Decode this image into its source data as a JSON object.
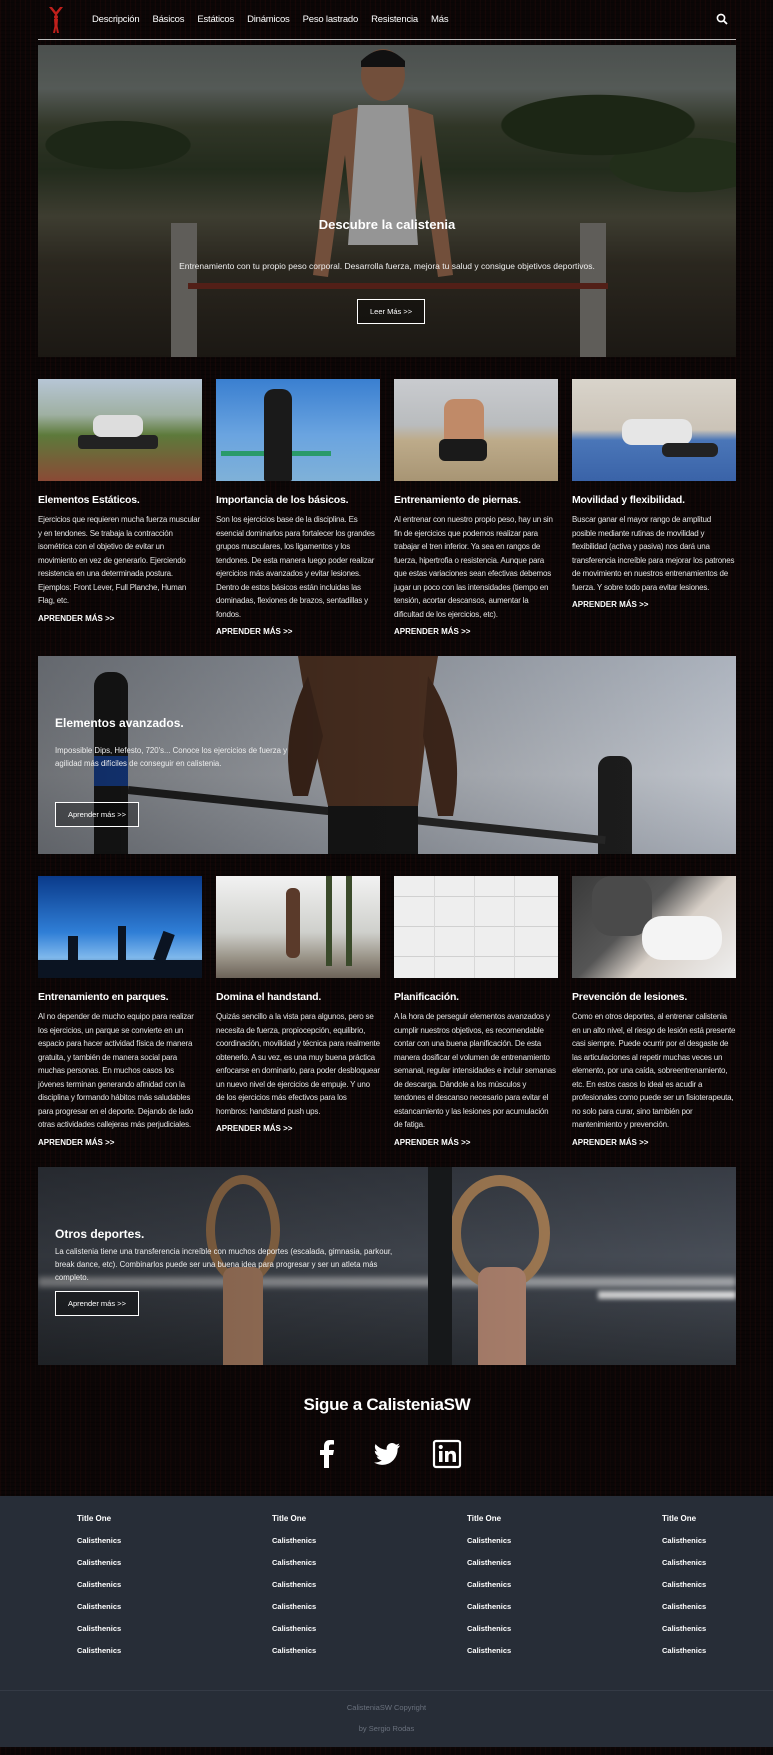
{
  "nav": {
    "items": [
      "Descripción",
      "Básicos",
      "Estáticos",
      "Dinámicos",
      "Peso lastrado",
      "Resistencia",
      "Más"
    ]
  },
  "hero": {
    "title": "Descubre la calistenia",
    "subtitle": "Entrenamiento con tu propio peso corporal. Desarrolla fuerza, mejora tu salud y consigue objetivos deportivos.",
    "button": "Leer Más >>"
  },
  "cards_row1": [
    {
      "title": "Elementos Estáticos.",
      "text": "Ejercicios que requieren mucha fuerza muscular y en tendones. Se trabaja la contracción isométrica con el objetivo de evitar un movimiento en vez de generarlo. Ejerciendo resistencia en una determinada postura. Ejemplos: Front Lever, Full Planche, Human Flag, etc.",
      "link": "APRENDER MÁS >>"
    },
    {
      "title": "Importancia de los básicos.",
      "text": "Son los ejercicios base de la disciplina. Es esencial dominarlos para fortalecer los grandes grupos musculares, los ligamentos y los tendones. De esta manera luego poder realizar ejercicios más avanzados y evitar lesiones. Dentro de estos básicos están incluidas las dominadas, flexiones de brazos, sentadillas y fondos.",
      "link": "APRENDER MÁS >>"
    },
    {
      "title": "Entrenamiento de piernas.",
      "text": "Al entrenar con nuestro propio peso, hay un sin fin de ejercicios que podemos realizar para trabajar el tren inferior. Ya sea en rangos de fuerza, hipertrofia o resistencia. Aunque para que estas variaciones sean efectivas debemos jugar un poco con las intensidades (tiempo en tensión, acortar descansos, aumentar la dificultad de los ejercicios, etc).",
      "link": "APRENDER MÁS >>"
    },
    {
      "title": "Movilidad y flexibilidad.",
      "text": "Buscar ganar el mayor rango de amplitud posible mediante rutinas de movilidad y flexibilidad (activa y pasiva) nos dará una transferencia increíble para mejorar los patrones de movimiento en nuestros entrenamientos de fuerza. Y sobre todo para evitar lesiones.",
      "link": "APRENDER MÁS >>"
    }
  ],
  "banner1": {
    "title": "Elementos avanzados.",
    "text": "Impossible Dips, Hefesto, 720's... Conoce los ejercicios de fuerza y agilidad más difíciles de conseguir en calistenia.",
    "button": "Aprender más >>"
  },
  "cards_row2": [
    {
      "title": "Entrenamiento en parques.",
      "text": "Al no depender de mucho equipo para realizar los ejercicios, un parque se convierte en un espacio para hacer actividad física de manera gratuita, y también de manera social para muchas personas. En muchos casos los jóvenes terminan generando afinidad con la disciplina y formando hábitos más saludables para progresar en el deporte. Dejando de lado otras actividades callejeras más perjudiciales.",
      "link": "APRENDER MÁS >>"
    },
    {
      "title": "Domina el handstand.",
      "text": "Quizás sencillo a la vista para algunos, pero se necesita de fuerza, propiocepción, equilibrio, coordinación, movilidad y técnica para realmente obtenerlo. A su vez, es una muy buena práctica enfocarse en dominarlo, para poder desbloquear un nuevo nivel de ejercicios de empuje. Y uno de los ejercicios más efectivos para los hombros: handstand push ups.",
      "link": "APRENDER MÁS >>"
    },
    {
      "title": "Planificación.",
      "text": "A la hora de perseguir elementos avanzados y cumplir nuestros objetivos, es recomendable contar con una buena planificación. De esta manera dosificar el volumen de entrenamiento semanal, regular intensidades e incluir semanas de descarga. Dándole a los músculos y tendones el descanso necesario para evitar el estancamiento y las lesiones por acumulación de fatiga.",
      "link": "APRENDER MÁS >>"
    },
    {
      "title": "Prevención de lesiones.",
      "text": "Como en otros deportes, al entrenar calistenia en un alto nivel, el riesgo de lesión está presente casi siempre. Puede ocurrir por el desgaste de las articulaciones al repetir muchas veces un elemento, por una caída, sobreentrenamiento, etc. En estos casos lo ideal es acudir a profesionales como puede ser un fisioterapeuta, no solo para curar, sino también por mantenimiento y prevención.",
      "link": "APRENDER MÁS >>"
    }
  ],
  "banner2": {
    "title": "Otros deportes.",
    "text": "La calistenia tiene una transferencia increíble con muchos deportes (escalada, gimnasia, parkour, break dance, etc). Combinarlos puede ser una buena idea para progresar y ser un atleta más completo.",
    "button": "Aprender más >>"
  },
  "social": {
    "title": "Sigue a CalisteniaSW",
    "icons": [
      "facebook-icon",
      "twitter-icon",
      "linkedin-icon"
    ]
  },
  "footer": {
    "columns": [
      {
        "title": "Title One",
        "links": [
          "Calisthenics",
          "Calisthenics",
          "Calisthenics",
          "Calisthenics",
          "Calisthenics",
          "Calisthenics"
        ]
      },
      {
        "title": "Title One",
        "links": [
          "Calisthenics",
          "Calisthenics",
          "Calisthenics",
          "Calisthenics",
          "Calisthenics",
          "Calisthenics"
        ]
      },
      {
        "title": "Title One",
        "links": [
          "Calisthenics",
          "Calisthenics",
          "Calisthenics",
          "Calisthenics",
          "Calisthenics",
          "Calisthenics"
        ]
      },
      {
        "title": "Title One",
        "links": [
          "Calisthenics",
          "Calisthenics",
          "Calisthenics",
          "Calisthenics",
          "Calisthenics",
          "Calisthenics"
        ]
      }
    ],
    "copyright": "CalisteniaSW Copyright",
    "author": "by Sergio Rodas"
  },
  "colors": {
    "logo": "#c0201c",
    "footer_bg": "#272d37",
    "page_bg": "#0b0606"
  }
}
